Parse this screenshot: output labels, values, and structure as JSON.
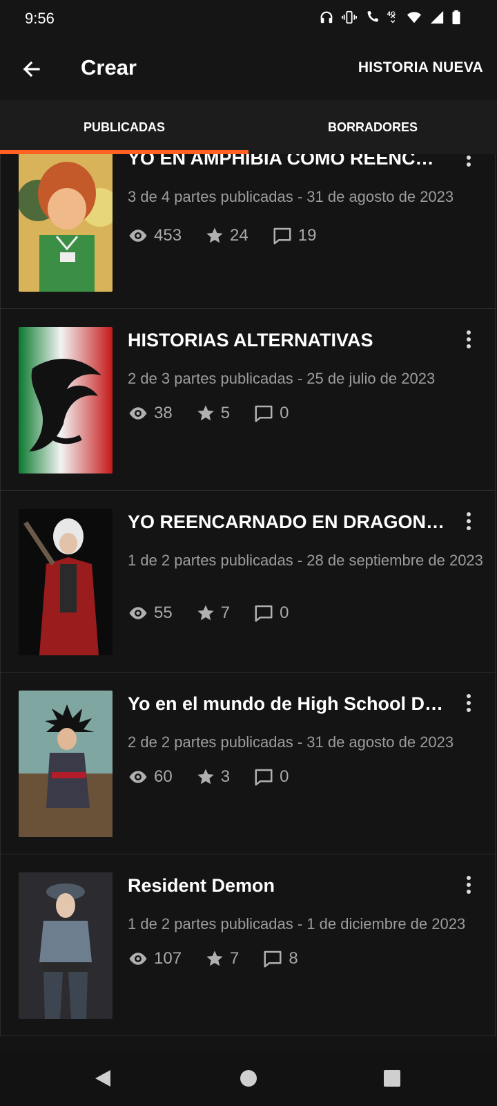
{
  "status_bar": {
    "time": "9:56",
    "icons": [
      "headphones-icon",
      "vibrate-icon",
      "wifi-calling-icon",
      "4g-icon",
      "wifi-icon",
      "signal-icon",
      "battery-icon"
    ]
  },
  "app_bar": {
    "title": "Crear",
    "new_story_label": "HISTORIA NUEVA"
  },
  "tabs": [
    {
      "label": "PUBLICADAS",
      "selected": true
    },
    {
      "label": "BORRADORES",
      "selected": false
    }
  ],
  "colors": {
    "accent": "#ff6122",
    "background": "#141414",
    "text_secondary": "#9c9c9c"
  },
  "stories": [
    {
      "title": "YO EN AMPHIBIA COMO REENCARNADO EN...",
      "meta": "3 de 4 partes publicadas - 31 de agosto de 2023",
      "views": "453",
      "votes": "24",
      "comments": "19"
    },
    {
      "title": "HISTORIAS ALTERNATIVAS",
      "meta": "2 de 3 partes publicadas - 25 de julio de 2023",
      "views": "38",
      "votes": "5",
      "comments": "0"
    },
    {
      "title": "YO REENCARNADO EN DRAGON BALL...",
      "meta": "1 de 2 partes publicadas - 28 de septiembre de 2023",
      "views": "55",
      "votes": "7",
      "comments": "0"
    },
    {
      "title": "Yo en el mundo de High School DxD...",
      "meta": "2 de 2 partes publicadas - 31 de agosto de 2023",
      "views": "60",
      "votes": "3",
      "comments": "0"
    },
    {
      "title": "Resident Demon",
      "meta": "1 de 2 partes publicadas - 1 de diciembre de 2023",
      "views": "107",
      "votes": "7",
      "comments": "8"
    }
  ],
  "nav_bar": {
    "buttons": [
      "back-nav-icon",
      "home-nav-icon",
      "recents-nav-icon"
    ]
  }
}
